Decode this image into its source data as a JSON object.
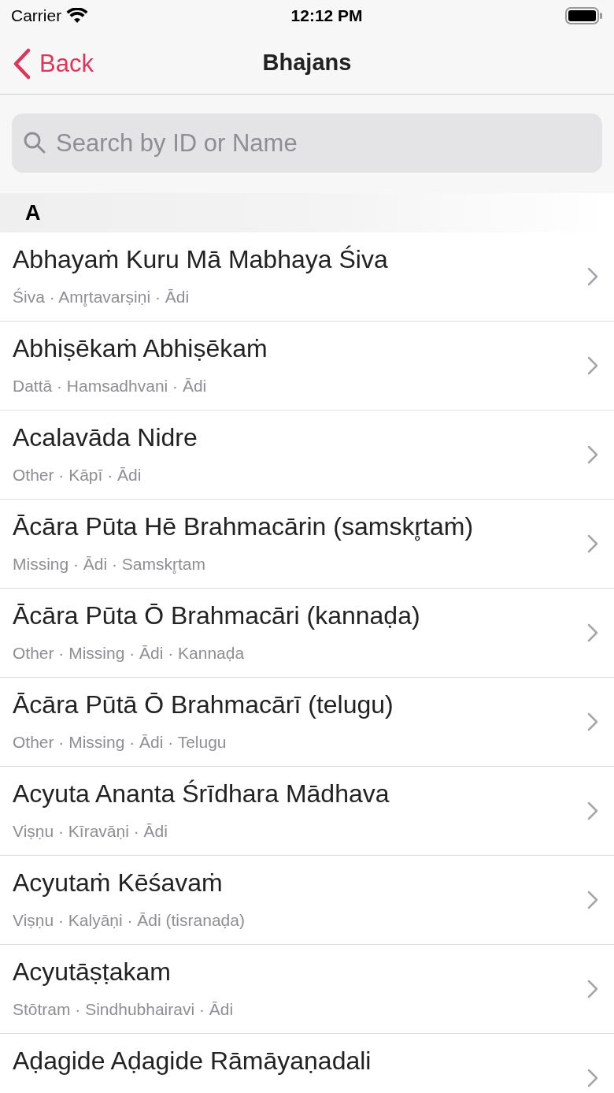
{
  "status_bar": {
    "carrier": "Carrier",
    "time": "12:12 PM"
  },
  "nav": {
    "back": "Back",
    "title": "Bhajans"
  },
  "search": {
    "placeholder": "Search by ID or Name"
  },
  "section": {
    "header": "A",
    "rows": [
      {
        "title": "Abhayaṁ Kuru Mā Mabhaya Śiva",
        "subtitle": "Śiva · Amr̥tavarṣiṇi · Ādi"
      },
      {
        "title": "Abhiṣēkaṁ Abhiṣēkaṁ",
        "subtitle": "Dattā · Hamsadhvani · Ādi"
      },
      {
        "title": "Acalavāda Nidre",
        "subtitle": "Other · Kāpī · Ādi"
      },
      {
        "title": "Ācāra Pūta Hē Brahmacārin (samskr̥taṁ)",
        "subtitle": "Missing · Ādi · Samskr̥tam"
      },
      {
        "title": "Ācāra Pūta Ō Brahmacāri (kannaḍa)",
        "subtitle": "Other · Missing · Ādi · Kannaḍa"
      },
      {
        "title": "Ācāra Pūtā Ō Brahmacārī (telugu)",
        "subtitle": "Other · Missing · Ādi · Telugu"
      },
      {
        "title": "Acyuta Ananta Śrīdhara Mādhava",
        "subtitle": "Viṣṇu · Kīravāṇi · Ādi"
      },
      {
        "title": "Acyutaṁ Kēśavaṁ",
        "subtitle": "Viṣṇu · Kalyāṇi · Ādi (tisranaḍa)"
      },
      {
        "title": "Acyutāṣṭakam",
        "subtitle": "Stōtram · Sindhubhairavi · Ādi"
      },
      {
        "title": "Aḍagide Aḍagide Rāmāyaṇadali"
      }
    ]
  }
}
